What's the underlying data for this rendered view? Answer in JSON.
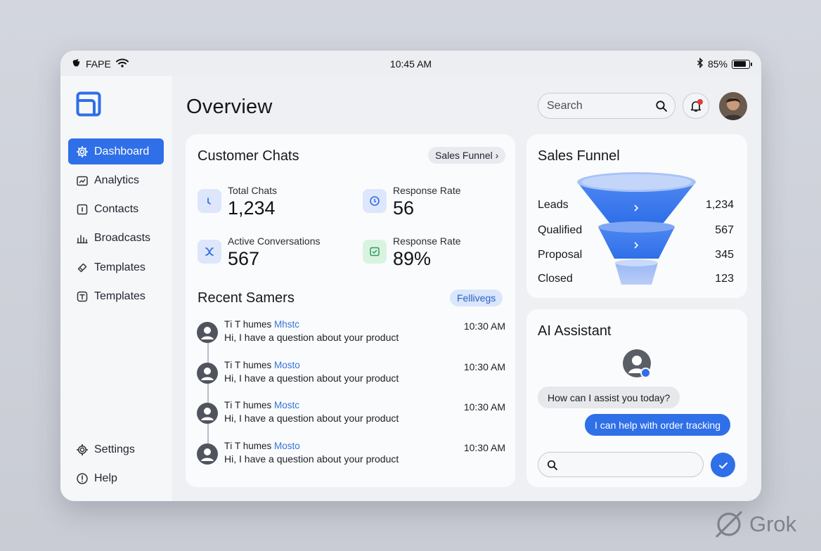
{
  "statusbar": {
    "carrier": "FAPE",
    "time": "10:45 AM",
    "battery": "85%",
    "battery_level": 0.85
  },
  "page": {
    "title": "Overview"
  },
  "search": {
    "placeholder": "Search"
  },
  "sidebar": {
    "items": [
      {
        "label": "Dashboard",
        "icon": "gear-icon",
        "active": true
      },
      {
        "label": "Analytics",
        "icon": "analytics-icon"
      },
      {
        "label": "Contacts",
        "icon": "contacts-icon"
      },
      {
        "label": "Broadcasts",
        "icon": "bar-chart-icon"
      },
      {
        "label": "Templates",
        "icon": "tag-icon"
      },
      {
        "label": "Templates",
        "icon": "template-icon"
      }
    ],
    "bottom": [
      {
        "label": "Settings",
        "icon": "gear-icon"
      },
      {
        "label": "Help",
        "icon": "info-icon"
      }
    ]
  },
  "chats": {
    "title": "Customer Chats",
    "chip": "Sales Funnel ›",
    "stats": [
      {
        "label": "Total Chats",
        "value": "1,234"
      },
      {
        "label": "Response Rate",
        "value": "56"
      },
      {
        "label": "Active Conversations",
        "value": "567"
      },
      {
        "label": "Response Rate",
        "value": "89%"
      }
    ],
    "recent_title": "Recent Samers",
    "recent_chip": "Fellivegs",
    "messages": [
      {
        "name": "Tі T humes ",
        "tag": "Mhstc",
        "text": "Hi, I have a question about your product",
        "time": "10:30 AM"
      },
      {
        "name": "Tі T humes ",
        "tag": "Mosto",
        "text": "Hi, I have a question about your product",
        "time": "10:30 AM"
      },
      {
        "name": "Tі T humes ",
        "tag": "Mostc",
        "text": "Hi, I have a question about your product",
        "time": "10:30 AM"
      },
      {
        "name": "Tі T humes ",
        "tag": "Mosto",
        "text": "Hi, I have a question about your product",
        "time": "10:30 AM"
      }
    ]
  },
  "funnel": {
    "title": "Sales Funnel",
    "rows": [
      {
        "label": "Leads",
        "value": "1,234"
      },
      {
        "label": "Qualified",
        "value": "567"
      },
      {
        "label": "Proposal",
        "value": "345"
      },
      {
        "label": "Closed",
        "value": "123"
      }
    ]
  },
  "ai": {
    "title": "AI Assistant",
    "incoming": "How can I assist you today?",
    "outgoing": "I can help with order tracking",
    "input_value": ""
  },
  "watermark": {
    "label": "Grok"
  },
  "colors": {
    "accent": "#2f6fe8",
    "notification": "#e23b3b",
    "link": "#3373d8"
  }
}
